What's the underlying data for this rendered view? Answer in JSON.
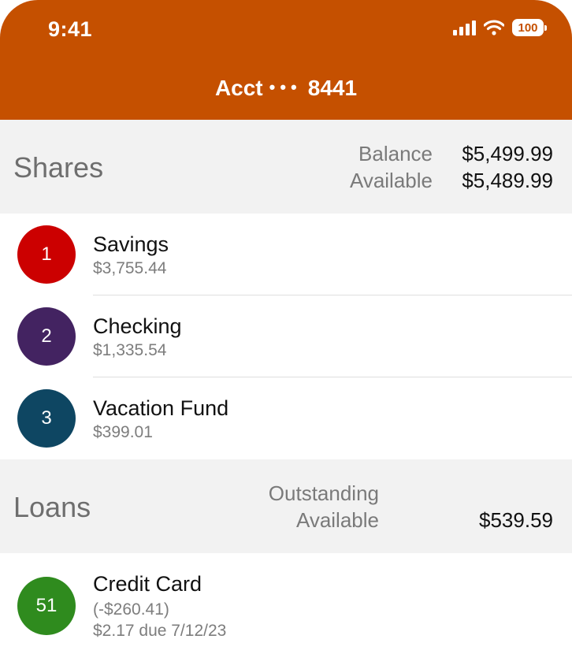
{
  "status_bar": {
    "time": "9:41",
    "battery": "100"
  },
  "header": {
    "prefix": "Acct",
    "dots": "•••",
    "number": "8441"
  },
  "shares": {
    "title": "Shares",
    "balance_label": "Balance",
    "balance_value": "$5,499.99",
    "available_label": "Available",
    "available_value": "$5,489.99",
    "items": [
      {
        "id": "1",
        "name": "Savings",
        "amount": "$3,755.44",
        "color": "#cc0000"
      },
      {
        "id": "2",
        "name": "Checking",
        "amount": "$1,335.54",
        "color": "#432361"
      },
      {
        "id": "3",
        "name": "Vacation Fund",
        "amount": "$399.01",
        "color": "#0e4662"
      }
    ]
  },
  "loans": {
    "title": "Loans",
    "outstanding_label": "Outstanding",
    "available_label": "Available",
    "available_value": "$539.59",
    "items": [
      {
        "id": "51",
        "name": "Credit Card",
        "balance": "(-$260.41)",
        "due": "$2.17 due 7/12/23",
        "color": "#2f8b1e"
      }
    ]
  },
  "colors": {
    "brand": "#c55000",
    "section_bg": "#f2f2f2"
  }
}
